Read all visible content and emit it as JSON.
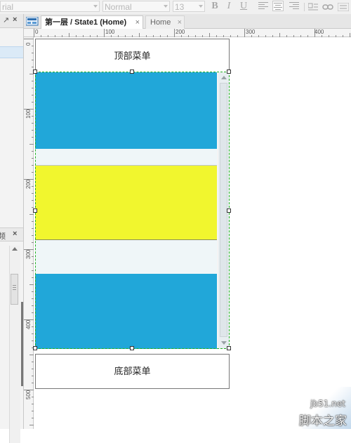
{
  "toolbar": {
    "font_family": "rial",
    "font_style": "Normal",
    "font_size": "13",
    "bold": "B",
    "italic": "I",
    "underline": "U"
  },
  "tabs": [
    {
      "label": "第一层 / State1 (Home)",
      "active": true
    },
    {
      "label": "Home",
      "active": false
    }
  ],
  "tab_close": "×",
  "left_panel": {
    "pin_icon": "↗",
    "close_icon": "×",
    "panel2_label": "频",
    "panel2_close": "×"
  },
  "ruler_top": [
    "0",
    "100",
    "200",
    "300",
    "400"
  ],
  "ruler_left": [
    "0",
    "100",
    "200",
    "300",
    "400",
    "500"
  ],
  "widgets": {
    "top_menu": "顶部菜单",
    "bottom_menu": "底部菜单"
  },
  "colors": {
    "blue_block": "#21a7d9",
    "yellow_block": "#f1f62e",
    "gap_block": "#eff6f8",
    "selection": "#20b020"
  },
  "watermark": {
    "site": "jb51.net",
    "name": "脚本之家"
  }
}
